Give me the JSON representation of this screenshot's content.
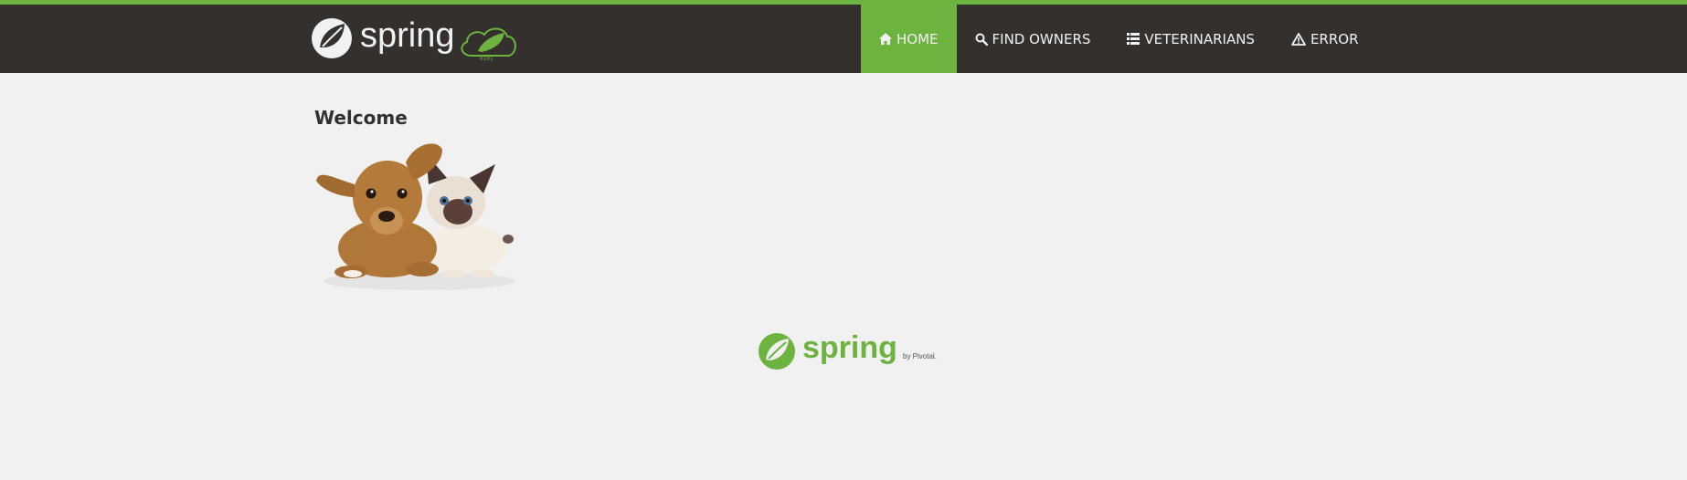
{
  "app": {
    "brand": {
      "logo_text": "spring",
      "badge_text": "0101"
    }
  },
  "nav": {
    "items": [
      {
        "label": "Home",
        "icon": "home-icon",
        "active": true
      },
      {
        "label": "Find owners",
        "icon": "search-icon",
        "active": false
      },
      {
        "label": "Veterinarians",
        "icon": "list-icon",
        "active": false
      },
      {
        "label": "Error",
        "icon": "warning-icon",
        "active": false
      }
    ]
  },
  "main": {
    "heading": "Welcome",
    "image": "pets-image"
  },
  "footer": {
    "logo_text": "spring",
    "byline": "by Pivotal."
  },
  "colors": {
    "brand_green": "#6db33f",
    "navbar_bg": "#34302d",
    "page_bg": "#f1f1f1",
    "text": "#34302d"
  }
}
